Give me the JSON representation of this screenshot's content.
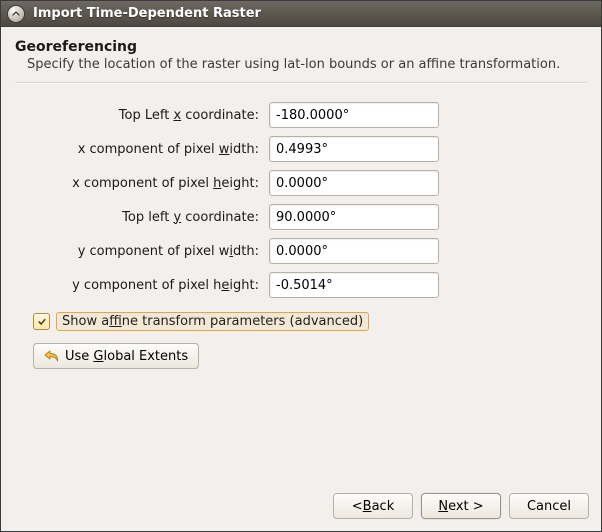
{
  "window": {
    "title": "Import Time-Dependent Raster"
  },
  "header": {
    "heading": "Georeferencing",
    "subheading": "Specify the location of the raster using lat-lon bounds or an affine transformation."
  },
  "fields": {
    "top_left_x": {
      "value": "-180.0000°"
    },
    "x_pixel_width": {
      "value": "0.4993°"
    },
    "x_pixel_height": {
      "value": "0.0000°"
    },
    "top_left_y": {
      "value": "90.0000°"
    },
    "y_pixel_width": {
      "value": "0.0000°"
    },
    "y_pixel_height": {
      "value": "-0.5014°"
    }
  },
  "labels": {
    "top_left_x_pre": "Top Left ",
    "top_left_x_mn": "x",
    "top_left_x_post": " coordinate:",
    "x_pw_pre": "x component of pixel ",
    "x_pw_mn": "w",
    "x_pw_post": "idth:",
    "x_ph_pre": "x component of pixel ",
    "x_ph_mn": "h",
    "x_ph_post": "eight:",
    "top_left_y_pre": "Top left ",
    "top_left_y_mn": "y",
    "top_left_y_post": " coordinate:",
    "y_pw_pre": "y component of pixel w",
    "y_pw_mn": "i",
    "y_pw_post": "dth:",
    "y_ph_pre": "y component of pixel h",
    "y_ph_mn": "e",
    "y_ph_post": "ight:"
  },
  "checkbox": {
    "pre": "Show a",
    "mn": "f",
    "post": "fine transform parameters (advanced)",
    "checked": true
  },
  "extents_button": {
    "pre": "Use ",
    "mn": "G",
    "post": "lobal Extents"
  },
  "footer": {
    "back_pre": "< ",
    "back_mn": "B",
    "back_post": "ack",
    "next_mn": "N",
    "next_post": "ext >",
    "cancel": "Cancel"
  }
}
